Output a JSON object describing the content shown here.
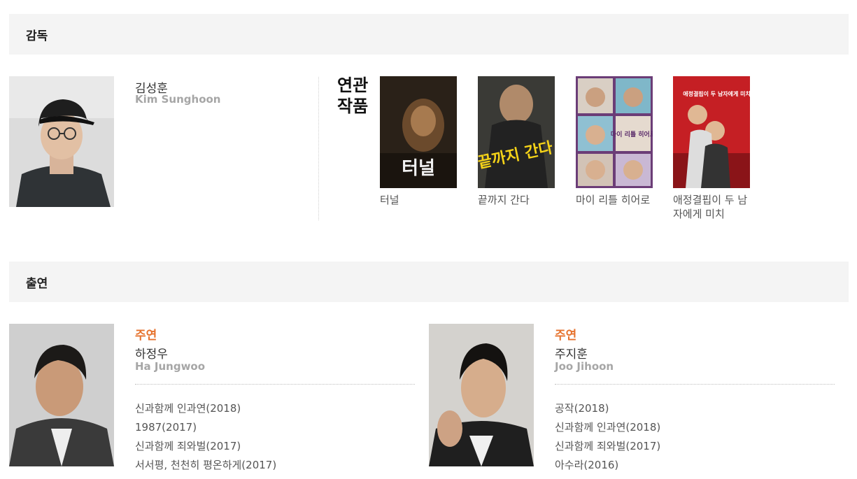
{
  "director_section": {
    "header": "감독",
    "director": {
      "name_kor": "김성훈",
      "name_eng": "Kim Sunghoon"
    },
    "related_label_line1": "연관",
    "related_label_line2": "작품",
    "films": [
      {
        "title": "터널",
        "poster_text": "터널"
      },
      {
        "title": "끝까지 간다",
        "poster_text": "끝까지 간다"
      },
      {
        "title": "마이 리틀 히어로",
        "poster_text": "마이 리틀 히어로"
      },
      {
        "title": "애정결핍이 두 남자에게 미치",
        "poster_text": "애정결핍이 두 남자에게 미치는 영향"
      }
    ]
  },
  "cast_section": {
    "header": "출연",
    "cast": [
      {
        "role": "주연",
        "name_kor": "하정우",
        "name_eng": "Ha Jungwoo",
        "filmography": [
          "신과함께 인과연(2018)",
          "1987(2017)",
          "신과함께 죄와벌(2017)",
          "서서평, 천천히 평온하게(2017)"
        ]
      },
      {
        "role": "주연",
        "name_kor": "주지훈",
        "name_eng": "Joo Jihoon",
        "filmography": [
          "공작(2018)",
          "신과함께 인과연(2018)",
          "신과함께 죄와벌(2017)",
          "아수라(2016)"
        ]
      }
    ]
  },
  "colors": {
    "role_accent": "#e6722d",
    "header_bg": "#f4f4f4",
    "eng_name": "#a6a6a6"
  }
}
